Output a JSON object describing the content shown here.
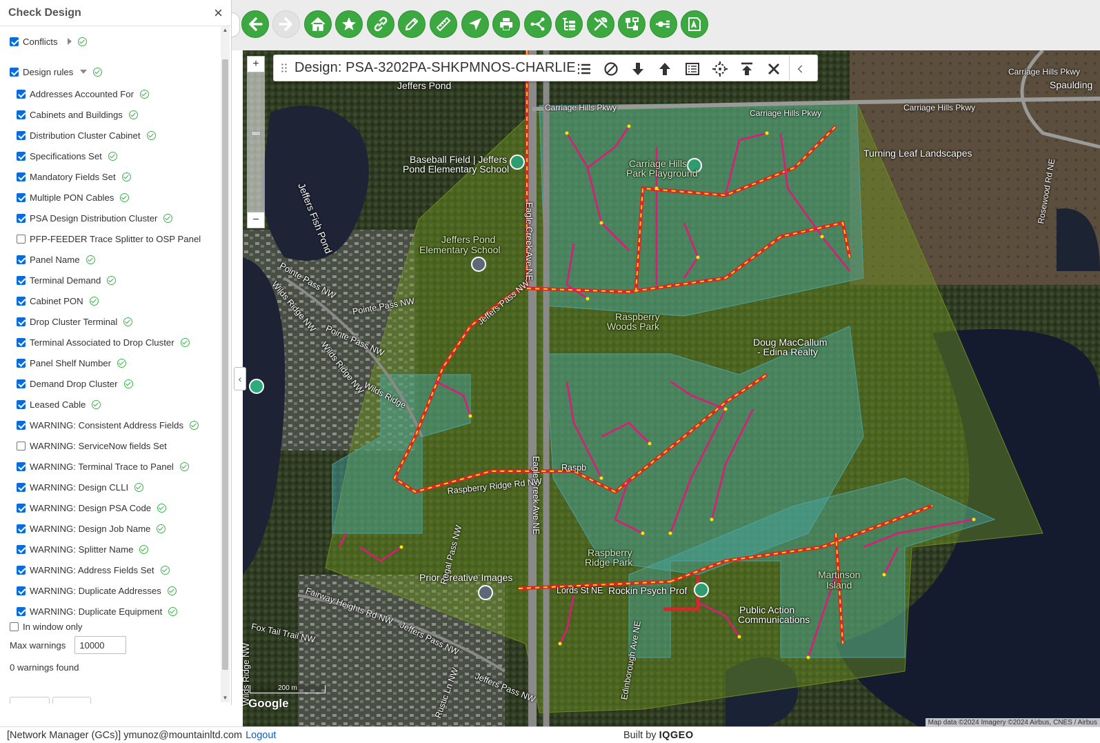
{
  "panel": {
    "title": "Check Design",
    "close_icon": "close-icon",
    "conflicts": {
      "label": "Conflicts",
      "checked": true,
      "expanded": false,
      "status": "ok"
    },
    "design_rules": {
      "label": "Design rules",
      "checked": true,
      "expanded": true,
      "status": "ok"
    },
    "rules": [
      {
        "label": "Addresses Accounted For",
        "checked": true,
        "ok": true
      },
      {
        "label": "Cabinets and Buildings",
        "checked": true,
        "ok": true
      },
      {
        "label": "Distribution Cluster Cabinet",
        "checked": true,
        "ok": true
      },
      {
        "label": "Specifications Set",
        "checked": true,
        "ok": true
      },
      {
        "label": "Mandatory Fields Set",
        "checked": true,
        "ok": true
      },
      {
        "label": "Multiple PON Cables",
        "checked": true,
        "ok": true
      },
      {
        "label": "PSA Design Distribution Cluster",
        "checked": true,
        "ok": true
      },
      {
        "label": "PFP-FEEDER Trace Splitter to OSP Panel",
        "checked": false,
        "ok": false
      },
      {
        "label": "Panel Name",
        "checked": true,
        "ok": true
      },
      {
        "label": "Terminal Demand",
        "checked": true,
        "ok": true
      },
      {
        "label": "Cabinet PON",
        "checked": true,
        "ok": true
      },
      {
        "label": "Drop Cluster Terminal",
        "checked": true,
        "ok": true
      },
      {
        "label": "Terminal Associated to Drop Cluster",
        "checked": true,
        "ok": true
      },
      {
        "label": "Panel Shelf Number",
        "checked": true,
        "ok": true
      },
      {
        "label": "Demand Drop Cluster",
        "checked": true,
        "ok": true
      },
      {
        "label": "Leased Cable",
        "checked": true,
        "ok": true
      },
      {
        "label": "WARNING: Consistent Address Fields",
        "checked": true,
        "ok": true
      },
      {
        "label": "WARNING: ServiceNow fields Set",
        "checked": false,
        "ok": false
      },
      {
        "label": "WARNING: Terminal Trace to Panel",
        "checked": true,
        "ok": true
      },
      {
        "label": "WARNING: Design CLLI",
        "checked": true,
        "ok": true
      },
      {
        "label": "WARNING: Design PSA Code",
        "checked": true,
        "ok": true
      },
      {
        "label": "WARNING: Design Job Name",
        "checked": true,
        "ok": true
      },
      {
        "label": "WARNING: Splitter Name",
        "checked": true,
        "ok": true
      },
      {
        "label": "WARNING: Address Fields Set",
        "checked": true,
        "ok": true
      },
      {
        "label": "WARNING: Duplicate Addresses",
        "checked": true,
        "ok": true
      },
      {
        "label": "WARNING: Duplicate Equipment",
        "checked": true,
        "ok": true
      }
    ],
    "in_window_only": {
      "label": "In window only",
      "checked": false
    },
    "max_warnings": {
      "label": "Max warnings",
      "value": "10000"
    },
    "result": "0 warnings found"
  },
  "toolbar": {
    "buttons": [
      {
        "name": "back-icon",
        "enabled": true
      },
      {
        "name": "forward-icon",
        "enabled": false
      },
      {
        "name": "home-icon",
        "enabled": true
      },
      {
        "name": "bookmark-star-icon",
        "enabled": true
      },
      {
        "name": "link-icon",
        "enabled": true
      },
      {
        "name": "edit-pencil-icon",
        "enabled": true
      },
      {
        "name": "measure-ruler-icon",
        "enabled": true
      },
      {
        "name": "navigate-arrow-icon",
        "enabled": true
      },
      {
        "name": "print-icon",
        "enabled": true
      },
      {
        "name": "network-trace-icon",
        "enabled": true
      },
      {
        "name": "structure-tree-icon",
        "enabled": true
      },
      {
        "name": "tools-icon",
        "enabled": true
      },
      {
        "name": "connections-icon",
        "enabled": true
      },
      {
        "name": "splice-icon",
        "enabled": true
      },
      {
        "name": "document-a-icon",
        "enabled": true
      }
    ],
    "accent": "#3ca940"
  },
  "design_bar": {
    "title": "Design: PSA-3202PA-SHKPMNOS-CHARLIE",
    "icons": [
      "list-icon",
      "cancel-icon",
      "arrow-down-icon",
      "arrow-up-icon",
      "details-list-icon",
      "locate-crosshair-icon",
      "publish-top-icon",
      "close-icon",
      "collapse-chevron-icon"
    ]
  },
  "map": {
    "zoom_in": "+",
    "zoom_out": "−",
    "labels": {
      "jeffers_pond": "Jeffers Pond",
      "carriage_hills_pkwy_1": "Carriage Hills Pkwy",
      "carriage_hills_pkwy_2": "Carriage Hills Pkwy",
      "carriage_hills_pkwy_3": "Carriage Hills Pkwy",
      "carriage_hills_pkwy_4": "Carriage Hills Pkwy",
      "spaulding": "Spaulding",
      "baseball_field": "Baseball Field | Jeffers",
      "baseball_field_2": "Pond Elementary School",
      "carriage_hills_park": "Carriage Hills",
      "carriage_hills_park_2": "Park Playground",
      "turning_leaf": "Turning Leaf Landscapes",
      "jeffers_fish_pond": "Jeffers Fish Pond",
      "rosewood_rd": "Rosewood Rd NE",
      "jeffers_pond_school": "Jeffers Pond",
      "jeffers_pond_school_2": "Elementary School",
      "pointe_pass_1": "Pointe Pass NW",
      "pointe_pass_2": "Pointe Pass NW",
      "pointe_pass_3": "Pointe Pass NW",
      "wilds_ridge_1": "Wilds Ridge NW",
      "wilds_ridge_2": "Wilds Ridge NW",
      "wilds_ridge_3": "Wilds Ridge",
      "jeffers_pass_1": "Jeffers Pass NW",
      "eagle_creek_1": "Eagle Creek Ave NE",
      "eagle_creek_2": "Eagle Creek Ave NE",
      "raspberry_woods": "Raspberry",
      "raspberry_woods_2": "Woods Park",
      "doug": "Doug MacCallum",
      "doug_2": "- Edina Realty",
      "raspberry_ridge_rd_1": "Raspberry Ridge Rd NW",
      "raspberry_ridge_rd_2": "Raspb",
      "raspberry_ridge_park": "Raspberry",
      "raspberry_ridge_park_2": "Ridge Park",
      "prior_creative": "Prior Creative Images",
      "regal_pass": "Regal Pass NW",
      "fairway_heights": "Fairway Heights Rd NW",
      "fox_tail": "Fox Tail Trail NW",
      "jeffers_pass_2": "Jeffers Pass NW",
      "jeffers_pass_3": "Jeffers Pass NW",
      "edinborough": "Edinborough Ave NE",
      "rockin": "Rockin Psych Prof",
      "martinson": "Martinson",
      "martinson_2": "Island",
      "public_action": "Public Action",
      "public_action_2": "Communications",
      "wilds_ridge_nw_v": "Wilds Ridge NW",
      "rustic": "Rustic Ln NW",
      "lords": "Lords St NE"
    },
    "scale": "200 m",
    "google": "Google",
    "attribution": "Map data ©2024 Imagery ©2024 Airbus, CNES / Airbus"
  },
  "statusbar": {
    "user": "[Network Manager (GCs)] ymunoz@mountainltd.com",
    "logout": "Logout",
    "built_by": "Built by",
    "brand": "IQGEO"
  }
}
